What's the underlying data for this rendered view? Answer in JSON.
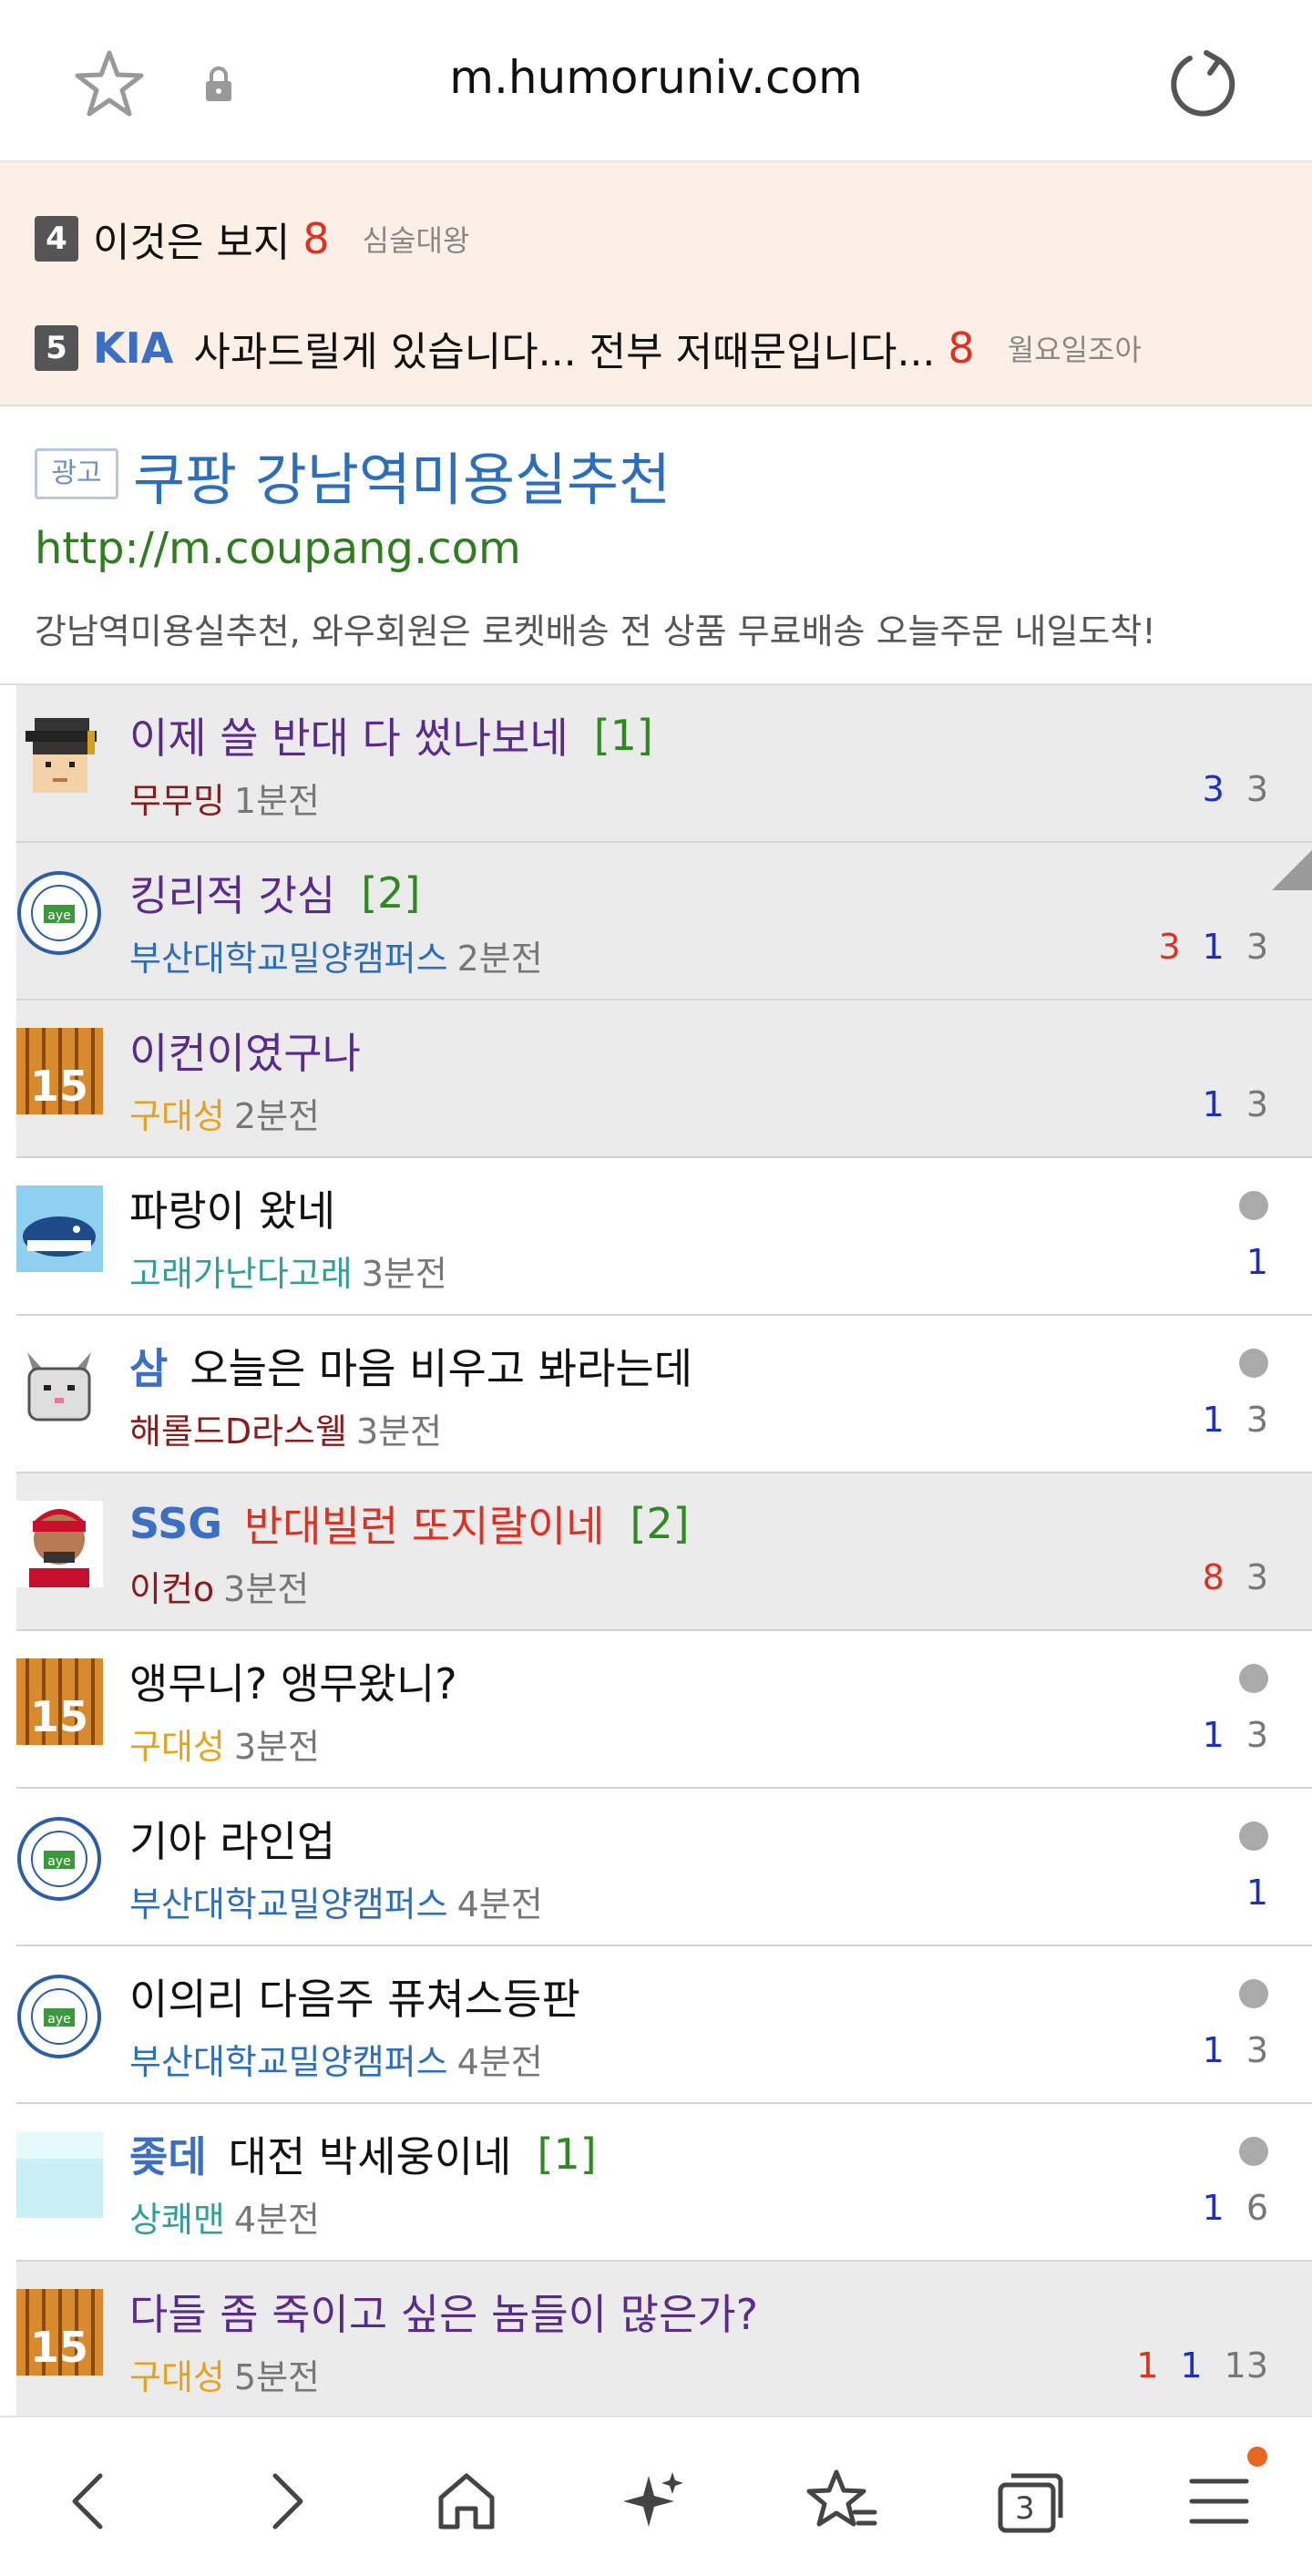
{
  "browser": {
    "url": "m.humoruniv.com",
    "bookmark_icon": "star-outline-icon",
    "lock_icon": "lock-icon",
    "reload_icon": "reload-icon"
  },
  "best": [
    {
      "rank": "4",
      "team": "",
      "title": "이것은 보지",
      "count": "8",
      "author": "심술대왕"
    },
    {
      "rank": "5",
      "team": "KIA",
      "title": "사과드릴게 있습니다... 전부 저때문입니다...",
      "count": "8",
      "author": "월요일조아"
    }
  ],
  "ad": {
    "badge": "광고",
    "title": "쿠팡 강남역미용실추천",
    "link": "http://m.coupang.com",
    "desc": "강남역미용실추천, 와우회원은 로켓배송 전 상품 무료배송 오늘주문 내일도착!"
  },
  "posts": [
    {
      "tag": "",
      "title": "이제 쓸 반대 다 썼나보네",
      "replies": "[1]",
      "author": "무무밍",
      "author_color": "#8b1a1a",
      "time": "1분전",
      "n1": "",
      "n2": "3",
      "n3": "3",
      "read": true,
      "title_color": "visited",
      "dot": false
    },
    {
      "tag": "",
      "title": "킹리적 갓심",
      "replies": "[2]",
      "author": "부산대학교밀양캠퍼스",
      "author_color": "#2a6ebd",
      "time": "2분전",
      "n1": "3",
      "n2": "1",
      "n3": "3",
      "read": true,
      "title_color": "visited",
      "dot": false
    },
    {
      "tag": "",
      "title": "이컨이였구나",
      "replies": "",
      "author": "구대성",
      "author_color": "#e6a31a",
      "time": "2분전",
      "n1": "",
      "n2": "1",
      "n3": "3",
      "read": true,
      "title_color": "visited",
      "dot": false
    },
    {
      "tag": "",
      "title": "파랑이 왔네",
      "replies": "",
      "author": "고래가난다고래",
      "author_color": "#2fa098",
      "time": "3분전",
      "n1": "",
      "n2": "1",
      "n3": "",
      "read": false,
      "title_color": "normal",
      "dot": true
    },
    {
      "tag": "삼",
      "title": "오늘은 마음 비우고 봐라는데",
      "replies": "",
      "author": "해롤드D라스웰",
      "author_color": "#8b1a1a",
      "time": "3분전",
      "n1": "",
      "n2": "1",
      "n3": "3",
      "read": false,
      "title_color": "normal",
      "dot": true
    },
    {
      "tag": "SSG",
      "title": "반대빌런 또지랄이네",
      "replies": "[2]",
      "author": "이컨o",
      "author_color": "#8b1a1a",
      "time": "3분전",
      "n1": "8",
      "n2": "",
      "n3": "3",
      "read": true,
      "title_color": "red",
      "dot": false
    },
    {
      "tag": "",
      "title": "앵무니? 앵무왔니?",
      "replies": "",
      "author": "구대성",
      "author_color": "#e6a31a",
      "time": "3분전",
      "n1": "",
      "n2": "1",
      "n3": "3",
      "read": false,
      "title_color": "normal",
      "dot": true
    },
    {
      "tag": "",
      "title": "기아 라인업",
      "replies": "",
      "author": "부산대학교밀양캠퍼스",
      "author_color": "#2a6ebd",
      "time": "4분전",
      "n1": "",
      "n2": "1",
      "n3": "",
      "read": false,
      "title_color": "normal",
      "dot": true
    },
    {
      "tag": "",
      "title": "이의리 다음주 퓨쳐스등판",
      "replies": "",
      "author": "부산대학교밀양캠퍼스",
      "author_color": "#2a6ebd",
      "time": "4분전",
      "n1": "",
      "n2": "1",
      "n3": "3",
      "read": false,
      "title_color": "normal",
      "dot": true
    },
    {
      "tag": "좆데",
      "title": "대전 박세웅이네",
      "replies": "[1]",
      "author": "상쾌맨",
      "author_color": "#2fa098",
      "time": "4분전",
      "n1": "",
      "n2": "1",
      "n3": "6",
      "read": false,
      "title_color": "normal",
      "dot": true
    },
    {
      "tag": "",
      "title": "다들 좀 죽이고 싶은 놈들이 많은가?",
      "replies": "",
      "author": "구대성",
      "author_color": "#e6a31a",
      "time": "5분전",
      "n1": "1",
      "n2": "1",
      "n3": "13",
      "read": true,
      "title_color": "visited",
      "dot": false
    }
  ],
  "nav": {
    "back_icon": "back-icon",
    "forward_icon": "forward-icon",
    "home_icon": "home-icon",
    "sparkle_icon": "sparkle-icon",
    "bookmarks_icon": "bookmarks-icon",
    "tabs_count": "3",
    "menu_icon": "menu-icon"
  }
}
